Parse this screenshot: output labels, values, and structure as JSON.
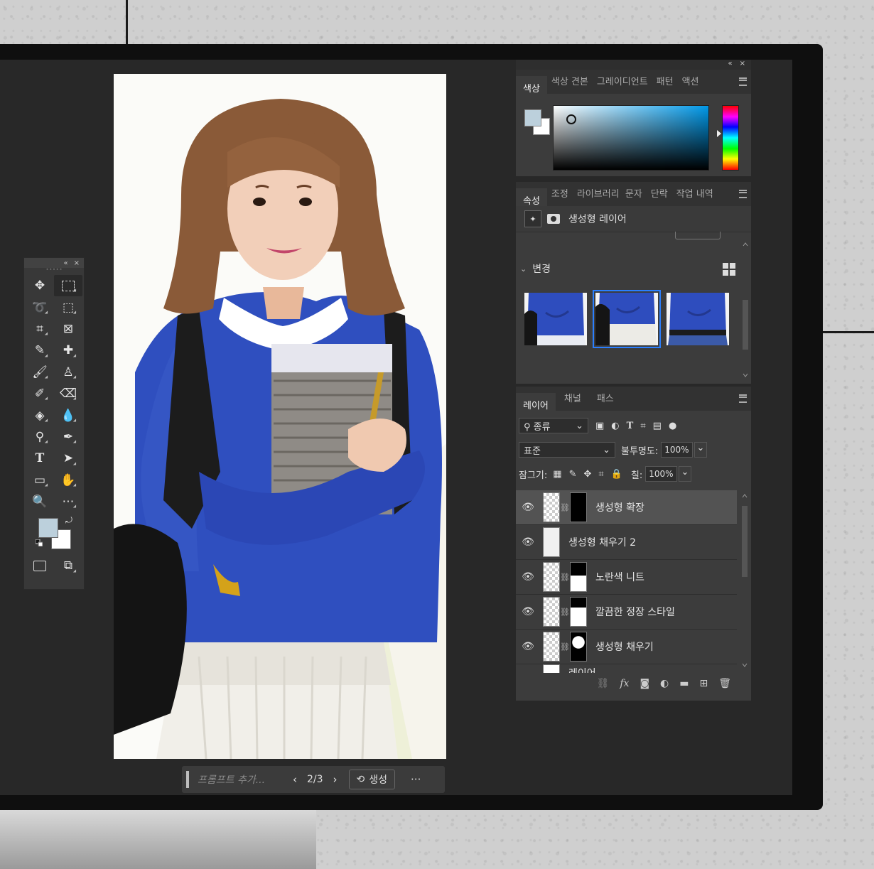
{
  "canvas_nav": {
    "placeholder": "프롬프트 추가...",
    "prev": "‹",
    "count": "2/3",
    "next": "›",
    "generate_label": "생성",
    "more": "···"
  },
  "panel_controls": {
    "collapse": "«",
    "close": "×"
  },
  "color_panel": {
    "tabs": [
      "색상",
      "색상 견본",
      "그레이디언트",
      "패턴",
      "액션"
    ],
    "foreground_color": "#bcd0dc",
    "background_color": "#ffffff"
  },
  "properties_panel": {
    "tabs": [
      "속성",
      "조정",
      "라이브러리",
      "문자",
      "단락",
      "작업 내역"
    ],
    "layer_type": "생성형 레이어",
    "variations_label": "변경",
    "variations_count": 3,
    "selected_variation": 2
  },
  "layers_panel": {
    "tabs": [
      "레이어",
      "채널",
      "패스"
    ],
    "filter_kind": "종류",
    "blend_mode": "표준",
    "opacity_label": "불투명도:",
    "opacity_value": "100%",
    "lock_label": "잠그기:",
    "fill_label": "칠:",
    "fill_value": "100%",
    "layers": [
      {
        "name": "생성형 확장",
        "selected": true
      },
      {
        "name": "생성형 채우기 2",
        "selected": false
      },
      {
        "name": "노란색 니트",
        "selected": false
      },
      {
        "name": "깔끔한 정장 스타일",
        "selected": false
      },
      {
        "name": "생성형 채우기",
        "selected": false
      },
      {
        "name": "레이어",
        "selected": false
      }
    ]
  },
  "toolbar": {
    "foreground_color": "#bcd0dc",
    "background_color": "#ffffff",
    "type_tool": "T"
  }
}
